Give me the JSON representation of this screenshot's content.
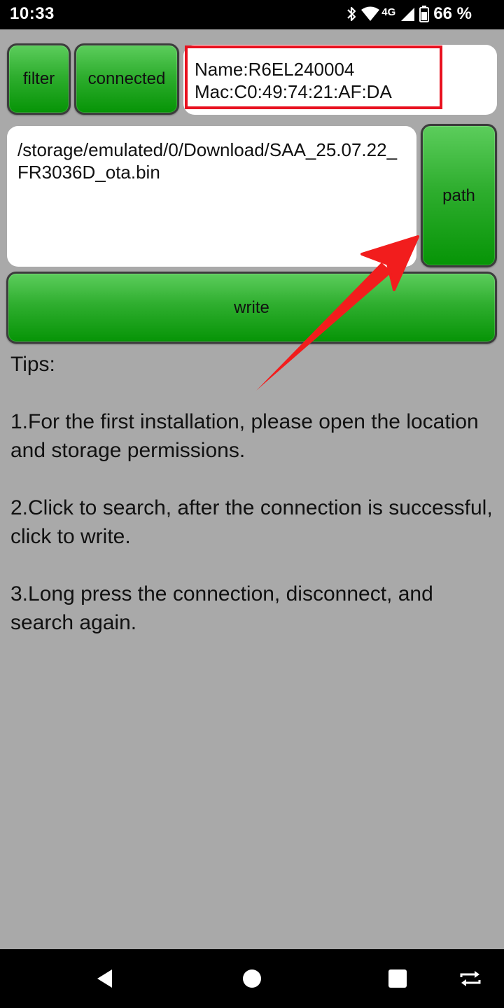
{
  "status_bar": {
    "time": "10:33",
    "network_label": "4G",
    "battery_text": "66 %",
    "icons": [
      "bluetooth-icon",
      "wifi-icon",
      "signal-icon",
      "battery-icon"
    ]
  },
  "toolbar": {
    "filter_label": "filter",
    "connected_label": "connected"
  },
  "device": {
    "name_line": "Name:R6EL240004",
    "mac_line": "Mac:C0:49:74:21:AF:DA"
  },
  "file": {
    "path_text": "/storage/emulated/0/Download/SAA_25.07.22_FR3036D_ota.bin",
    "path_button_label": "path"
  },
  "actions": {
    "write_label": "write"
  },
  "tips": {
    "heading": "Tips:",
    "items": [
      "1.For the first installation, please open the location and storage permissions.",
      "2.Click to search, after the connection is successful, click to write.",
      "3.Long press the connection, disconnect, and search again."
    ]
  },
  "nav_bar": {
    "buttons": [
      "back-icon",
      "home-icon",
      "recents-icon",
      "rotate-icon"
    ]
  },
  "colors": {
    "background": "#a9a9a9",
    "button_green": "#069406",
    "highlight_red": "#e8111f",
    "arrow_red": "#f21d1d"
  }
}
